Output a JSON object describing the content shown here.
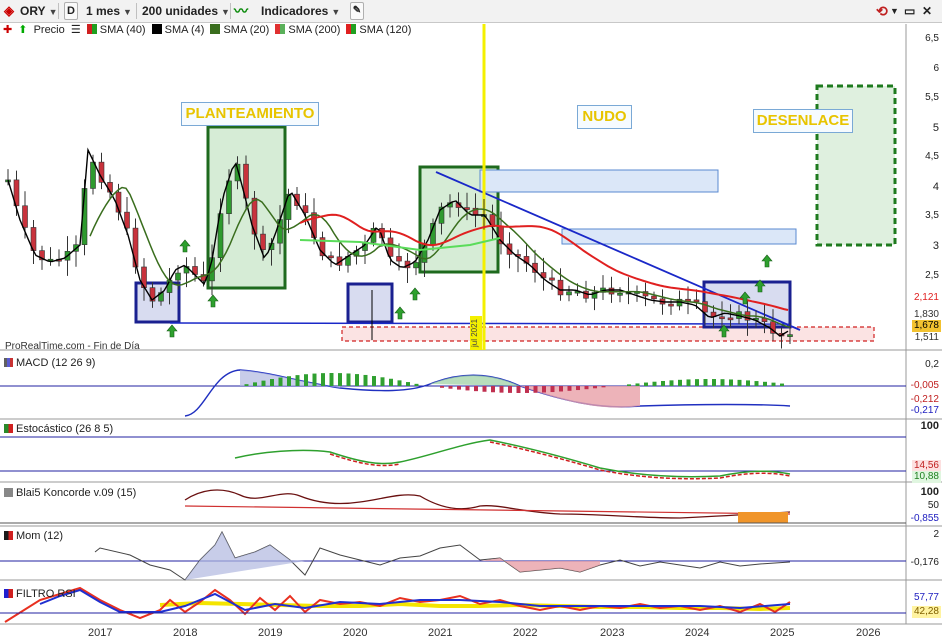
{
  "toolbar": {
    "symbol": "ORY",
    "d_label": "D",
    "timeframe": "1 mes",
    "units": "200 unidades",
    "indicators": "Indicadores"
  },
  "legend": {
    "price": "Precio",
    "sma40": "SMA (40)",
    "sma4": "SMA (4)",
    "sma20": "SMA (20)",
    "sma200": "SMA (200)",
    "sma120": "SMA (120)"
  },
  "main_chart": {
    "source": "ProRealTime.com - Fin de Día",
    "labels": {
      "planteamiento": "PLANTEAMIENTO",
      "nudo": "NUDO",
      "desenlace": "DESENLACE"
    },
    "vertical_marker": "jul 2021",
    "y_ticks": [
      "6,5",
      "6",
      "5,5",
      "5",
      "4,5",
      "4",
      "3,5",
      "3",
      "2,5"
    ],
    "price_tags": {
      "sma200": "2,121",
      "sma120": "1,830",
      "last": "1,678",
      "low": "1,511"
    },
    "colors": {
      "up": "#2e9a2e",
      "down": "#c8323c",
      "sma200": "#e02020",
      "sma20": "#3a6e1e",
      "sma4": "#000000",
      "trend": "#1a28c8"
    }
  },
  "panels": {
    "macd": {
      "title": "MACD (12 26 9)",
      "ticks": [
        "0,2",
        "-0,005",
        "-0,212",
        "-0,217"
      ]
    },
    "stoch": {
      "title": "Estocástico (26 8 5)",
      "ticks": [
        "100",
        "14,56",
        "10,88"
      ]
    },
    "koncorde": {
      "title": "Blai5 Koncorde v.09 (15)",
      "ticks": [
        "100",
        "50",
        "-0,855"
      ]
    },
    "mom": {
      "title": "Mom (12)",
      "ticks": [
        "2",
        "-0,176"
      ]
    },
    "rsi": {
      "title": "FILTRO RSI",
      "ticks": [
        "57,77",
        "42,28"
      ]
    }
  },
  "x_axis": [
    "2017",
    "2018",
    "2019",
    "2020",
    "2021",
    "2022",
    "2023",
    "2024",
    "2025",
    "2026"
  ]
}
